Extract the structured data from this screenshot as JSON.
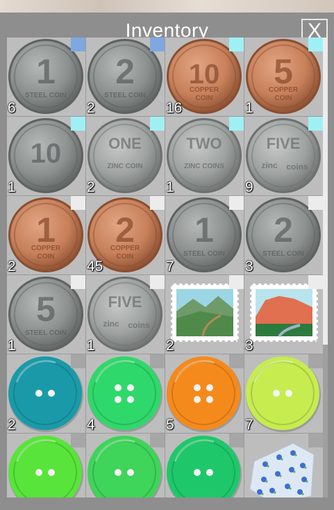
{
  "window": {
    "title": "Inventory",
    "close_label": "X"
  },
  "colors": {
    "panel": "#8e8e8e",
    "cell": "#bdbdbd",
    "corner_blue": "#7fa8e0",
    "corner_cyan": "#9ff0f5",
    "corner_white": "#ececec",
    "corner_grey": "#a6a6a6"
  },
  "items": [
    {
      "name": "steel-coin-1",
      "qty": "6",
      "corner": "blue",
      "art": "coin",
      "metal": "steel",
      "big": "1",
      "line": "STEEL COIN",
      "sub": ""
    },
    {
      "name": "steel-coin-2",
      "qty": "2",
      "corner": "blue",
      "art": "coin",
      "metal": "steel",
      "big": "2",
      "line": "STEEL COIN",
      "sub": ""
    },
    {
      "name": "copper-coin-10",
      "qty": "16",
      "corner": "cyan",
      "art": "coin",
      "metal": "copper",
      "big": "10",
      "line": "COPPER",
      "sub": "COIN"
    },
    {
      "name": "copper-coin-5",
      "qty": "1",
      "corner": "cyan",
      "art": "coin",
      "metal": "copper",
      "big": "5",
      "line": "COPPER",
      "sub": "COIN"
    },
    {
      "name": "steel-coin-10",
      "qty": "1",
      "corner": "cyan",
      "art": "coin",
      "metal": "steel",
      "big": "10",
      "line": "",
      "sub": ""
    },
    {
      "name": "zinc-coin-one",
      "qty": "2",
      "corner": "cyan",
      "art": "coin",
      "metal": "zinc",
      "big": "ONE",
      "line": "ZINC COIN",
      "sub": ""
    },
    {
      "name": "zinc-coins-two",
      "qty": "1",
      "corner": "cyan",
      "art": "coin",
      "metal": "zinc",
      "big": "TWO",
      "line": "ZINC COINS",
      "sub": ""
    },
    {
      "name": "zinc-coins-five",
      "qty": "9",
      "corner": "cyan",
      "art": "coin",
      "metal": "zinc",
      "big": "FIVE",
      "line": "zinc",
      "sub": "coins"
    },
    {
      "name": "copper-coin-1",
      "qty": "2",
      "corner": "white",
      "art": "coin",
      "metal": "copper",
      "big": "1",
      "line": "COPPER",
      "sub": "COIN"
    },
    {
      "name": "copper-coin-2",
      "qty": "45",
      "corner": "white",
      "art": "coin",
      "metal": "copper",
      "big": "2",
      "line": "COPPER",
      "sub": "COIN"
    },
    {
      "name": "steel-coin-1b",
      "qty": "7",
      "corner": "white",
      "art": "coin",
      "metal": "steel",
      "big": "1",
      "line": "STEEL COIN",
      "sub": ""
    },
    {
      "name": "steel-coin-2b",
      "qty": "3",
      "corner": "white",
      "art": "coin",
      "metal": "steel",
      "big": "2",
      "line": "STEEL COIN",
      "sub": ""
    },
    {
      "name": "steel-coin-5",
      "qty": "1",
      "corner": "white",
      "art": "coin",
      "metal": "steel",
      "big": "5",
      "line": "STEEL COIN",
      "sub": ""
    },
    {
      "name": "zinc-coins-five-b",
      "qty": "1",
      "corner": "white",
      "art": "coin",
      "metal": "zinc",
      "big": "FIVE",
      "line": "zinc",
      "sub": "coins"
    },
    {
      "name": "stamp-valley",
      "qty": "2",
      "corner": "white",
      "art": "stamp",
      "variant": "valley"
    },
    {
      "name": "stamp-mountain",
      "qty": "3",
      "corner": "white",
      "art": "stamp",
      "variant": "mountain"
    },
    {
      "name": "button-teal",
      "qty": "2",
      "corner": "grey",
      "art": "button",
      "color": "#1a9aa8",
      "holes": 2
    },
    {
      "name": "button-green",
      "qty": "4",
      "corner": "grey",
      "art": "button",
      "color": "#2fd86a",
      "holes": 4
    },
    {
      "name": "button-orange",
      "qty": "5",
      "corner": "grey",
      "art": "button",
      "color": "#f58a1c",
      "holes": 4
    },
    {
      "name": "button-lime",
      "qty": "7",
      "corner": "grey",
      "art": "button",
      "color": "#c6ec50",
      "holes": 2
    },
    {
      "name": "button-bright-green",
      "qty": "",
      "corner": "grey",
      "art": "button",
      "color": "#58e43a",
      "holes": 2
    },
    {
      "name": "button-mid-green",
      "qty": "",
      "corner": "grey",
      "art": "button",
      "color": "#3fd45a",
      "holes": 2
    },
    {
      "name": "button-emerald",
      "qty": "",
      "corner": "grey",
      "art": "button",
      "color": "#1ec86a",
      "holes": 2
    },
    {
      "name": "fabric-floral",
      "qty": "",
      "corner": "grey",
      "art": "fabric"
    }
  ]
}
